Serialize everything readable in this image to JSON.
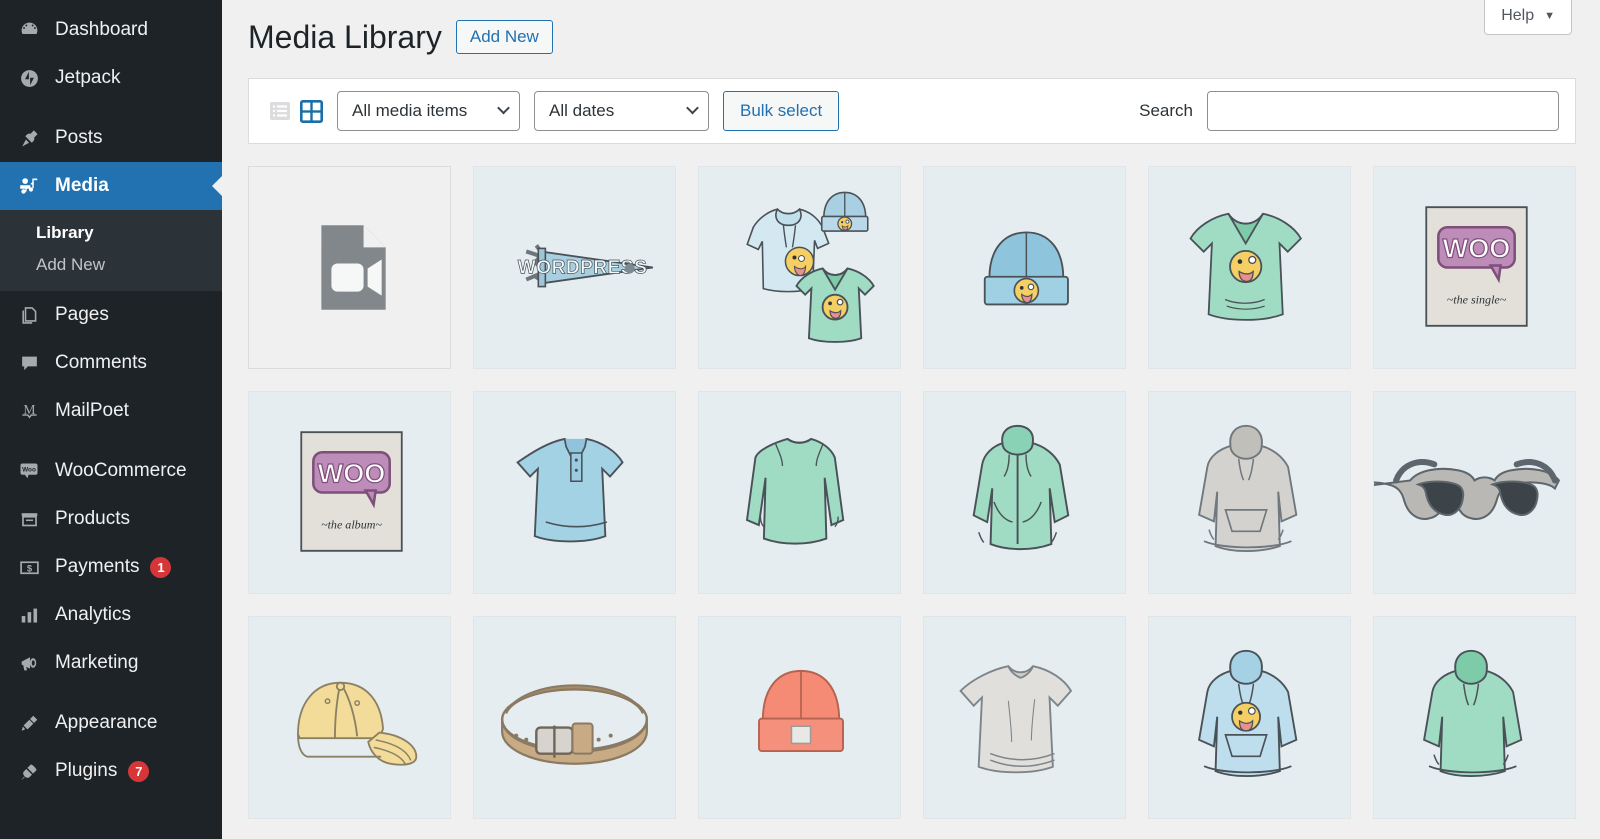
{
  "sidebar": {
    "items": [
      {
        "label": "Dashboard",
        "icon": "dashboard-icon",
        "badge": null,
        "current": false,
        "sep_after": false
      },
      {
        "label": "Jetpack",
        "icon": "jetpack-icon",
        "badge": null,
        "current": false,
        "sep_after": true
      },
      {
        "label": "Posts",
        "icon": "pin-icon",
        "badge": null,
        "current": false,
        "sep_after": false
      },
      {
        "label": "Media",
        "icon": "media-icon",
        "badge": null,
        "current": true,
        "sep_after": false
      },
      {
        "label": "Pages",
        "icon": "pages-icon",
        "badge": null,
        "current": false,
        "sep_after": false
      },
      {
        "label": "Comments",
        "icon": "comment-icon",
        "badge": null,
        "current": false,
        "sep_after": false
      },
      {
        "label": "MailPoet",
        "icon": "mailpoet-icon",
        "badge": null,
        "current": false,
        "sep_after": true
      },
      {
        "label": "WooCommerce",
        "icon": "woo-icon",
        "badge": null,
        "current": false,
        "sep_after": false
      },
      {
        "label": "Products",
        "icon": "products-icon",
        "badge": null,
        "current": false,
        "sep_after": false
      },
      {
        "label": "Payments",
        "icon": "payments-icon",
        "badge": "1",
        "current": false,
        "sep_after": false
      },
      {
        "label": "Analytics",
        "icon": "analytics-icon",
        "badge": null,
        "current": false,
        "sep_after": false
      },
      {
        "label": "Marketing",
        "icon": "marketing-icon",
        "badge": null,
        "current": false,
        "sep_after": true
      },
      {
        "label": "Appearance",
        "icon": "appearance-icon",
        "badge": null,
        "current": false,
        "sep_after": false
      },
      {
        "label": "Plugins",
        "icon": "plugins-icon",
        "badge": "7",
        "current": false,
        "sep_after": false
      }
    ],
    "submenu": {
      "parent": "Media",
      "items": [
        {
          "label": "Library",
          "current": true
        },
        {
          "label": "Add New",
          "current": false
        }
      ]
    },
    "colors": {
      "background": "#1d2327",
      "submenu_background": "#2c3338",
      "current": "#2271b1",
      "badge": "#d63638"
    }
  },
  "header": {
    "title": "Media Library",
    "add_new_label": "Add New",
    "help_label": "Help",
    "help_caret": "▼"
  },
  "toolbar": {
    "list_view_icon": "list-view-icon",
    "grid_view_icon": "grid-view-icon",
    "active_view": "grid",
    "media_filter": {
      "value": "All media items"
    },
    "date_filter": {
      "value": "All dates"
    },
    "bulk_select_label": "Bulk select",
    "search_label": "Search",
    "search_value": "",
    "search_placeholder": ""
  },
  "grid": {
    "items": [
      {
        "art": "video-file",
        "type": "file",
        "filename": "video.mp4",
        "name": "video-mp4"
      },
      {
        "art": "pennant",
        "type": "image",
        "filename": "",
        "name": "wordpress-pennant"
      },
      {
        "art": "apparel-group",
        "type": "image",
        "filename": "",
        "name": "apparel-group"
      },
      {
        "art": "beanie-blue",
        "type": "image",
        "filename": "",
        "name": "blue-beanie"
      },
      {
        "art": "vneck-green",
        "type": "image",
        "filename": "",
        "name": "green-vneck-tshirt"
      },
      {
        "art": "woo-single",
        "type": "image",
        "filename": "",
        "name": "woo-the-single-album-cover"
      },
      {
        "art": "woo-album",
        "type": "image",
        "filename": "",
        "name": "woo-the-album-cover"
      },
      {
        "art": "polo-blue",
        "type": "image",
        "filename": "",
        "name": "blue-polo-shirt"
      },
      {
        "art": "longsleeve-green",
        "type": "image",
        "filename": "",
        "name": "green-long-sleeve-tee"
      },
      {
        "art": "zip-hoodie-green",
        "type": "image",
        "filename": "",
        "name": "green-zip-hoodie"
      },
      {
        "art": "hoodie-gray",
        "type": "image",
        "filename": "",
        "name": "gray-hoodie"
      },
      {
        "art": "sunglasses",
        "type": "image",
        "filename": "",
        "name": "sunglasses"
      },
      {
        "art": "cap-yellow",
        "type": "image",
        "filename": "",
        "name": "yellow-cap"
      },
      {
        "art": "belt",
        "type": "image",
        "filename": "",
        "name": "leather-belt"
      },
      {
        "art": "beanie-red",
        "type": "image",
        "filename": "",
        "name": "red-beanie"
      },
      {
        "art": "tshirt-gray",
        "type": "image",
        "filename": "",
        "name": "gray-tshirt"
      },
      {
        "art": "hoodie-blue-logo",
        "type": "image",
        "filename": "",
        "name": "blue-logo-hoodie"
      },
      {
        "art": "hoodie-green",
        "type": "image",
        "filename": "",
        "name": "green-hoodie"
      }
    ],
    "art_text": {
      "pennant": "WORDPRESS",
      "woo_logo": "WOO",
      "woo_single_sub": "~the  single~",
      "woo_album_sub": "~the  album~"
    }
  }
}
